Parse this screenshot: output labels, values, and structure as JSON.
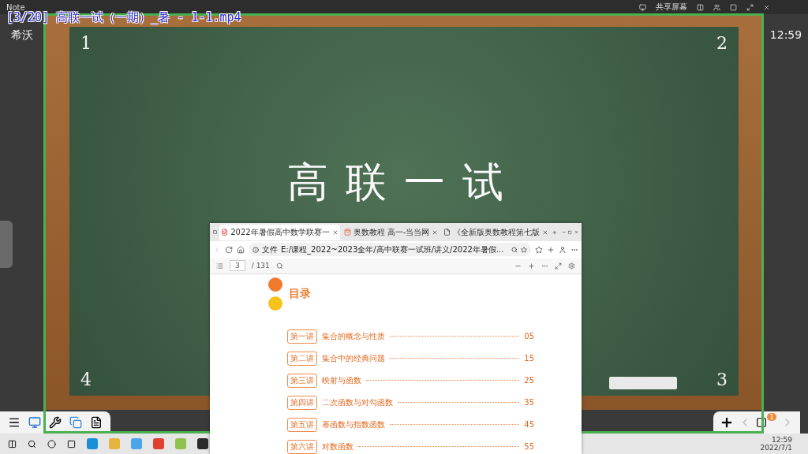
{
  "top_bar": {
    "app_name": "Note",
    "share_label": "共享屏幕"
  },
  "overlay_title": "[3/20] 高联一试（一期）_暑 - 1-1.mp4",
  "side_labels": {
    "left": "希沃",
    "right_time": "12:59"
  },
  "board": {
    "corners": [
      "1",
      "2",
      "4",
      "3"
    ],
    "handwriting": "高联一试"
  },
  "browser": {
    "tabs": [
      {
        "label": "2022年暑假高中数学联赛一",
        "selected": true,
        "kind": "pdf"
      },
      {
        "label": "奥数教程 高一-当当网",
        "selected": false,
        "kind": "shop"
      },
      {
        "label": "《全新版奥数教程第七版",
        "selected": false,
        "kind": "page"
      }
    ],
    "address": {
      "prefix": "文件",
      "url": "E:/课程_2022~2023全年/高中联赛一试班/讲义/2022年暑假..."
    },
    "pdf_toolbar": {
      "page": "3",
      "total": "/ 131"
    },
    "heading": "目录",
    "toc": [
      {
        "lecture": "第一讲",
        "title": "集合的概念与性质",
        "page": "05"
      },
      {
        "lecture": "第二讲",
        "title": "集合中的经典问题",
        "page": "15"
      },
      {
        "lecture": "第三讲",
        "title": "映射与函数",
        "page": "25"
      },
      {
        "lecture": "第四讲",
        "title": "二次函数与对勾函数",
        "page": "35"
      },
      {
        "lecture": "第五讲",
        "title": "幂函数与指数函数",
        "page": "45"
      },
      {
        "lecture": "第六讲",
        "title": "对数函数",
        "page": "55"
      }
    ]
  },
  "page_nav": {
    "badge": "1"
  },
  "clock": {
    "time": "12:59",
    "date": "2022/7/1"
  }
}
